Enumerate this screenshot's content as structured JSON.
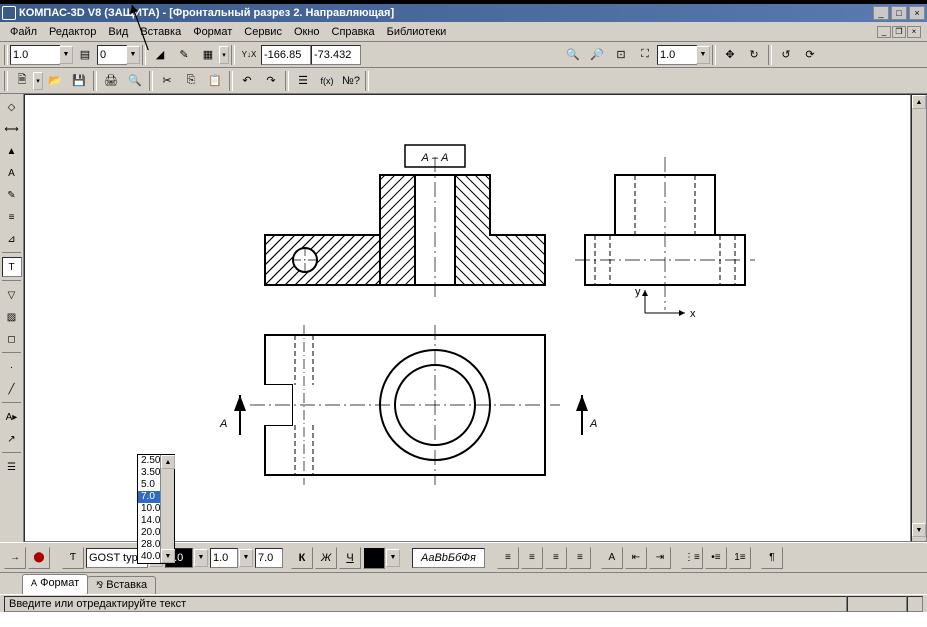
{
  "app": {
    "title": "КОМПАС-3D V8 (ЗАЩИТА) - [Фронтальный разрез 2. Направляющая]"
  },
  "menu": {
    "file": "Файл",
    "edit": "Редактор",
    "view": "Вид",
    "insert": "Вставка",
    "format": "Формат",
    "service": "Сервис",
    "window": "Окно",
    "help": "Справка",
    "libs": "Библиотеки"
  },
  "tb1": {
    "scale": "1.0",
    "coordX": "-166.85",
    "coordY": "-73.432",
    "zoom": "1.0"
  },
  "tb2": {},
  "sizeDropdown": {
    "options": [
      "2.50",
      "3.50",
      "5.0",
      "7.0",
      "10.0",
      "14.0",
      "20.0",
      "28.0",
      "40.0"
    ],
    "selected": "7.0"
  },
  "prop": {
    "font": "GOST type",
    "sizeA": "7.0",
    "lineSpacing": "1.0",
    "sizeB": "7.0",
    "preview": "АаВbБбФя",
    "bold": "К",
    "italic": "Ж",
    "underline": "Ч"
  },
  "tabs": {
    "format": "Формат",
    "insert": "Вставка"
  },
  "status": {
    "msg": "Введите или отредактируйте текст"
  },
  "drawing": {
    "section_label": "А – А",
    "section_marker_left": "А",
    "section_marker_right": "А",
    "axis_x": "x",
    "axis_y": "y"
  }
}
